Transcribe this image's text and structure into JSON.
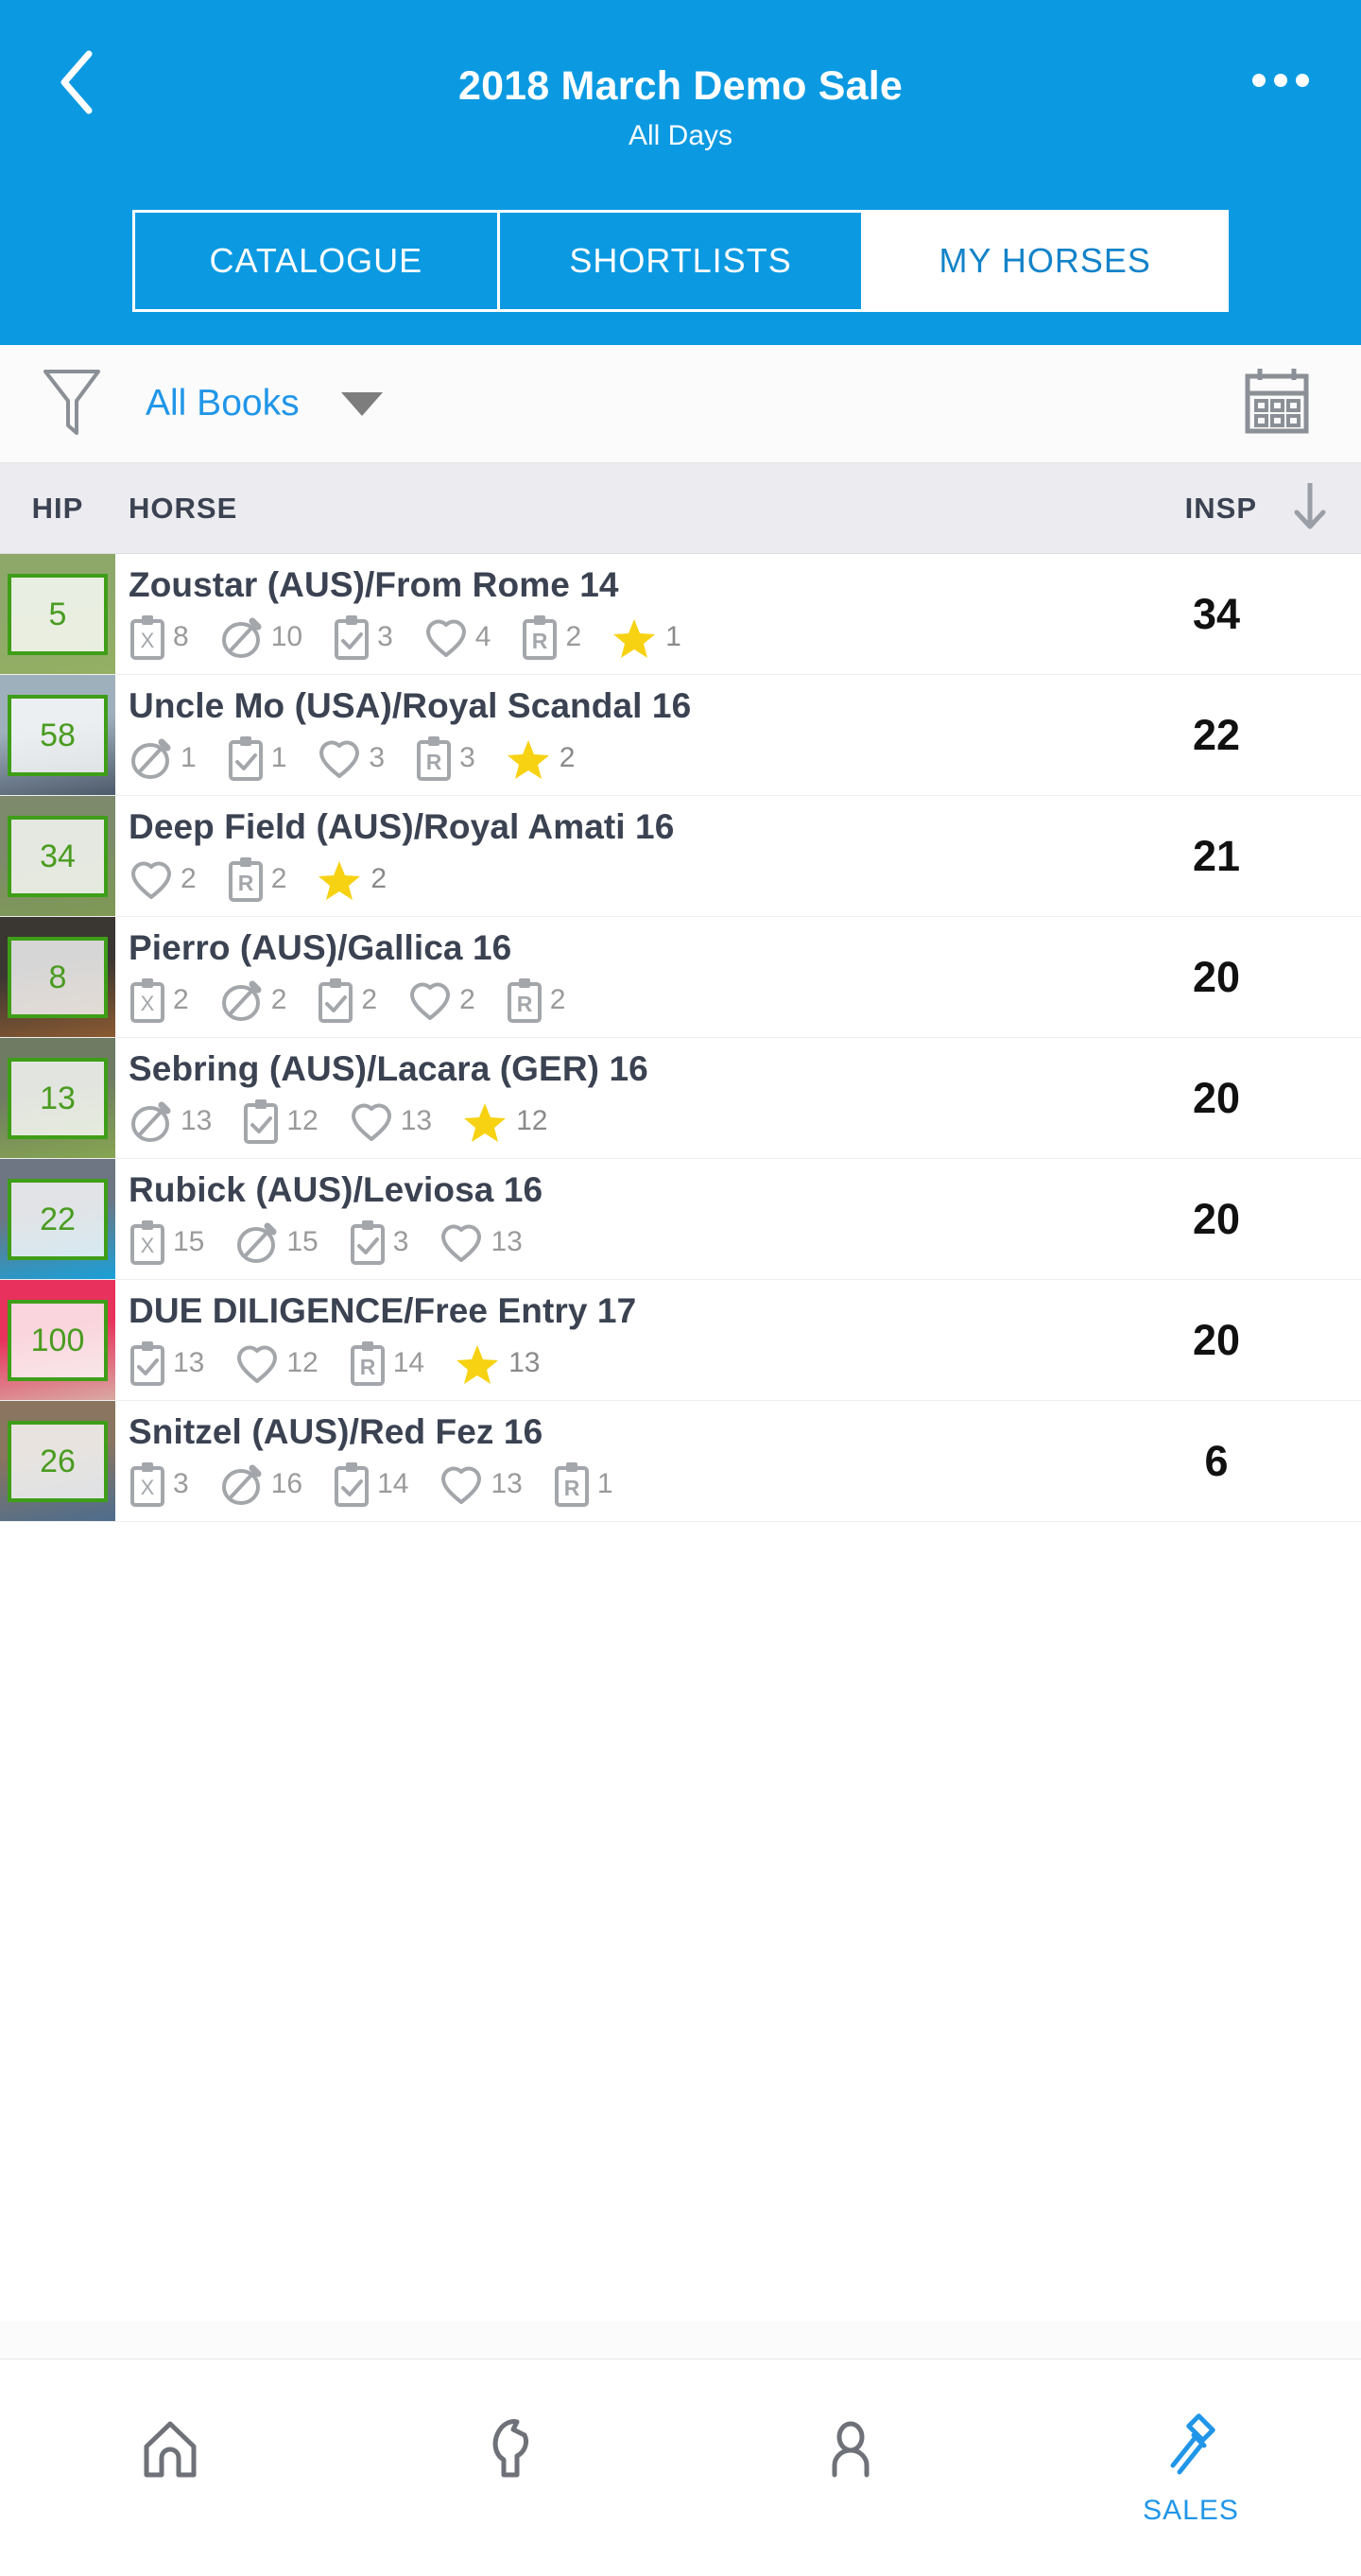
{
  "header": {
    "back_icon": "chevron-left-icon",
    "title": "2018 March Demo Sale",
    "subtitle": "All Days",
    "more_icon": "overflow-menu-icon",
    "tabs": [
      {
        "label": "CATALOGUE",
        "active": false
      },
      {
        "label": "SHORTLISTS",
        "active": false
      },
      {
        "label": "MY HORSES",
        "active": true
      }
    ]
  },
  "filter_bar": {
    "funnel_icon": "filter-funnel-icon",
    "book_filter_value": "All Books",
    "dropdown_icon": "chevron-down-icon",
    "calendar_icon": "calendar-icon"
  },
  "table": {
    "columns": {
      "hip": "HIP",
      "horse": "HORSE",
      "insp": "INSP"
    },
    "sort_icon": "arrow-down-icon",
    "rows": [
      {
        "hip": "5",
        "name": "Zoustar (AUS)/From Rome 14",
        "insp": "34",
        "photo_top": "#8ea86a",
        "photo_bottom": "#93b063",
        "stats": [
          {
            "icon": "clipboard-x-icon",
            "count": "8"
          },
          {
            "icon": "circle-slash-icon",
            "count": "10"
          },
          {
            "icon": "clipboard-check-icon",
            "count": "3"
          },
          {
            "icon": "heart-icon",
            "count": "4"
          },
          {
            "icon": "clipboard-r-icon",
            "count": "2"
          },
          {
            "icon": "star-icon",
            "count": "1"
          }
        ]
      },
      {
        "hip": "58",
        "name": "Uncle Mo (USA)/Royal Scandal 16",
        "insp": "22",
        "photo_top": "#9fb0bd",
        "photo_bottom": "#4d5a6b",
        "stats": [
          {
            "icon": "circle-slash-icon",
            "count": "1"
          },
          {
            "icon": "clipboard-check-icon",
            "count": "1"
          },
          {
            "icon": "heart-icon",
            "count": "3"
          },
          {
            "icon": "clipboard-r-icon",
            "count": "3"
          },
          {
            "icon": "star-icon",
            "count": "2"
          }
        ]
      },
      {
        "hip": "34",
        "name": "Deep Field (AUS)/Royal Amati 16",
        "insp": "21",
        "photo_top": "#7d8a6b",
        "photo_bottom": "#7e9a54",
        "stats": [
          {
            "icon": "heart-icon",
            "count": "2"
          },
          {
            "icon": "clipboard-r-icon",
            "count": "2"
          },
          {
            "icon": "star-icon",
            "count": "2"
          }
        ]
      },
      {
        "hip": "8",
        "name": "Pierro (AUS)/Gallica 16",
        "insp": "20",
        "photo_top": "#3a3632",
        "photo_bottom": "#8a5a32",
        "stats": [
          {
            "icon": "clipboard-x-icon",
            "count": "2"
          },
          {
            "icon": "circle-slash-icon",
            "count": "2"
          },
          {
            "icon": "clipboard-check-icon",
            "count": "2"
          },
          {
            "icon": "heart-icon",
            "count": "2"
          },
          {
            "icon": "clipboard-r-icon",
            "count": "2"
          }
        ]
      },
      {
        "hip": "13",
        "name": "Sebring (AUS)/Lacara (GER) 16",
        "insp": "20",
        "photo_top": "#6f7b63",
        "photo_bottom": "#86a551",
        "stats": [
          {
            "icon": "circle-slash-icon",
            "count": "13"
          },
          {
            "icon": "clipboard-check-icon",
            "count": "12"
          },
          {
            "icon": "heart-icon",
            "count": "13"
          },
          {
            "icon": "star-icon",
            "count": "12"
          }
        ]
      },
      {
        "hip": "22",
        "name": "Rubick (AUS)/Leviosa 16",
        "insp": "20",
        "photo_top": "#6d7682",
        "photo_bottom": "#1aa0d8",
        "stats": [
          {
            "icon": "clipboard-x-icon",
            "count": "15"
          },
          {
            "icon": "circle-slash-icon",
            "count": "15"
          },
          {
            "icon": "clipboard-check-icon",
            "count": "3"
          },
          {
            "icon": "heart-icon",
            "count": "13"
          }
        ]
      },
      {
        "hip": "100",
        "name": "DUE DILIGENCE/Free Entry 17",
        "insp": "20",
        "photo_top": "#e8315c",
        "photo_bottom": "#d9a9a3",
        "stats": [
          {
            "icon": "clipboard-check-icon",
            "count": "13"
          },
          {
            "icon": "heart-icon",
            "count": "12"
          },
          {
            "icon": "clipboard-r-icon",
            "count": "14"
          },
          {
            "icon": "star-icon",
            "count": "13"
          }
        ]
      },
      {
        "hip": "26",
        "name": "Snitzel (AUS)/Red Fez 16",
        "insp": "6",
        "photo_top": "#8a7560",
        "photo_bottom": "#4d6d8e",
        "stats": [
          {
            "icon": "clipboard-x-icon",
            "count": "3"
          },
          {
            "icon": "circle-slash-icon",
            "count": "16"
          },
          {
            "icon": "clipboard-check-icon",
            "count": "14"
          },
          {
            "icon": "heart-icon",
            "count": "13"
          },
          {
            "icon": "clipboard-r-icon",
            "count": "1"
          }
        ]
      }
    ]
  },
  "bottom_nav": [
    {
      "icon": "home-icon",
      "label": "",
      "active": false
    },
    {
      "icon": "horse-head-icon",
      "label": "",
      "active": false
    },
    {
      "icon": "person-icon",
      "label": "",
      "active": false
    },
    {
      "icon": "gavel-icon",
      "label": "SALES",
      "active": true
    }
  ],
  "colors": {
    "brand_blue": "#0b9ae2",
    "link_blue": "#2196e8",
    "badge_green": "#3f9e18",
    "star_yellow": "#f6d40b",
    "header_grey": "#ececf0"
  }
}
